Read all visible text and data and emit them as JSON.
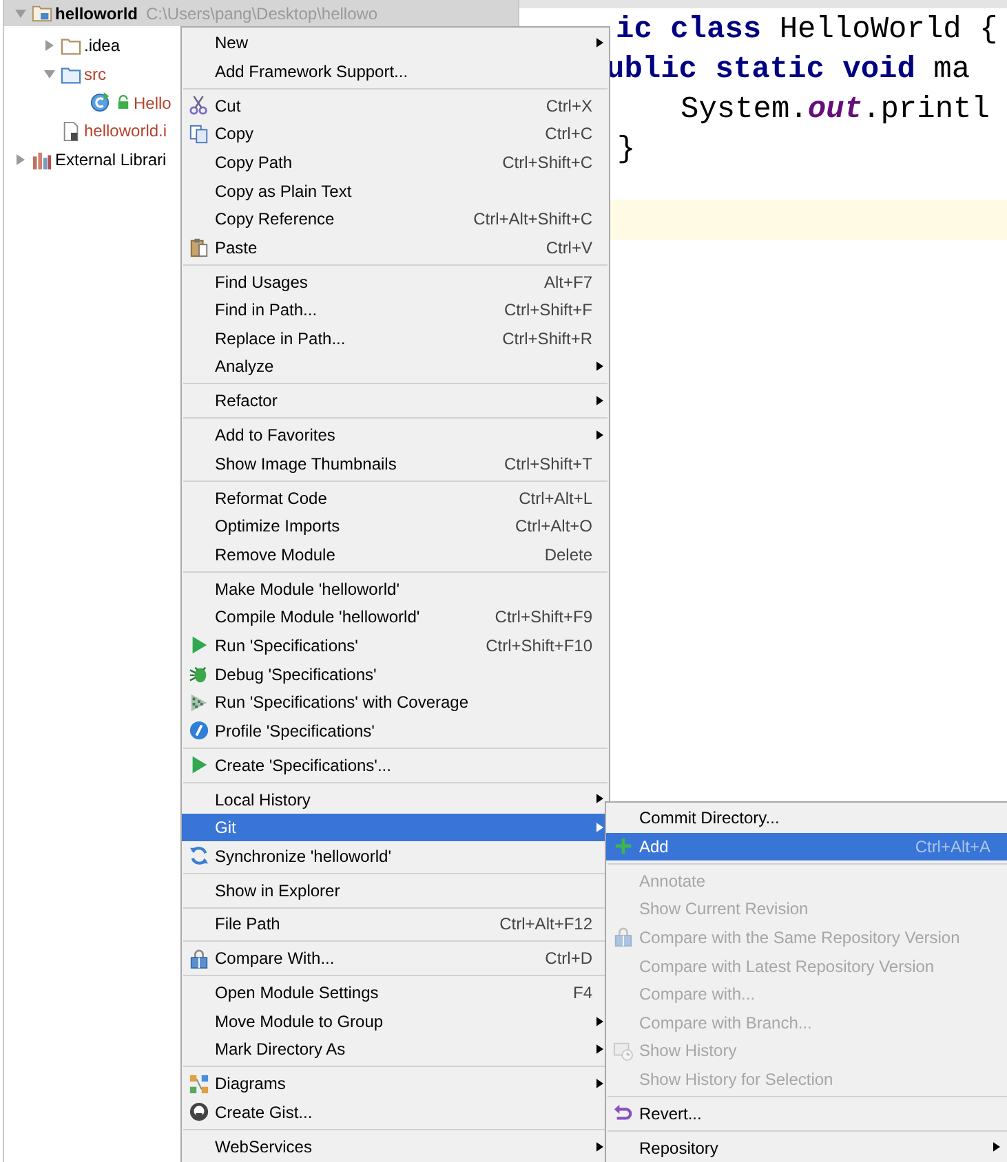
{
  "project_tree": {
    "items": [
      {
        "label": "helloworld",
        "path": "C:\\Users\\pang\\Desktop\\hellowo",
        "kind": "module",
        "expanded": true,
        "unversioned": false,
        "selected": true,
        "children": [
          {
            "label": ".idea",
            "kind": "folder",
            "expanded": false,
            "unversioned": false,
            "selected": false
          },
          {
            "label": "src",
            "kind": "source_folder",
            "expanded": true,
            "unversioned": true,
            "selected": false,
            "children": [
              {
                "label": "Hello",
                "kind": "class",
                "unversioned": true,
                "selected": false
              }
            ]
          },
          {
            "label": "helloworld.i",
            "kind": "module_file",
            "unversioned": true,
            "selected": false
          }
        ]
      },
      {
        "label": "External Librari",
        "kind": "libraries",
        "expanded": false,
        "unversioned": false,
        "selected": false
      }
    ]
  },
  "editor": {
    "lines": [
      {
        "current": false,
        "tokens": [
          {
            "text": "ic ",
            "kind": "keyword"
          },
          {
            "text": "class ",
            "kind": "keyword"
          },
          {
            "text": "HelloWorld {",
            "kind": "plain"
          }
        ]
      },
      {
        "current": false,
        "tokens": [
          {
            "text": "ublic static void ",
            "kind": "keyword"
          },
          {
            "text": "ma",
            "kind": "plain"
          }
        ]
      },
      {
        "current": false,
        "tokens": [
          {
            "text": "System.",
            "kind": "plain"
          },
          {
            "text": "out",
            "kind": "field"
          },
          {
            "text": ".printl",
            "kind": "plain"
          }
        ]
      },
      {
        "current": false,
        "tokens": [
          {
            "text": "}",
            "kind": "plain"
          }
        ]
      },
      {
        "current": true
      }
    ]
  },
  "context_menu": {
    "groups": [
      {
        "items": [
          {
            "label": "New",
            "kind": "plain",
            "submenu": true,
            "selected": false
          },
          {
            "label": "Add Framework Support...",
            "kind": "plain",
            "submenu": false,
            "selected": false
          }
        ]
      },
      {
        "items": [
          {
            "label": "Cut",
            "shortcut": "Ctrl+X",
            "kind": "cut",
            "submenu": false,
            "selected": false
          },
          {
            "label": "Copy",
            "shortcut": "Ctrl+C",
            "kind": "copy",
            "submenu": false,
            "selected": false
          },
          {
            "label": "Copy Path",
            "shortcut": "Ctrl+Shift+C",
            "kind": "plain",
            "submenu": false,
            "selected": false
          },
          {
            "label": "Copy as Plain Text",
            "kind": "plain",
            "submenu": false,
            "selected": false
          },
          {
            "label": "Copy Reference",
            "shortcut": "Ctrl+Alt+Shift+C",
            "kind": "plain",
            "submenu": false,
            "selected": false
          },
          {
            "label": "Paste",
            "shortcut": "Ctrl+V",
            "kind": "paste",
            "submenu": false,
            "selected": false
          }
        ]
      },
      {
        "items": [
          {
            "label": "Find Usages",
            "shortcut": "Alt+F7",
            "kind": "plain",
            "submenu": false,
            "selected": false
          },
          {
            "label": "Find in Path...",
            "shortcut": "Ctrl+Shift+F",
            "kind": "plain",
            "submenu": false,
            "selected": false
          },
          {
            "label": "Replace in Path...",
            "shortcut": "Ctrl+Shift+R",
            "kind": "plain",
            "submenu": false,
            "selected": false
          },
          {
            "label": "Analyze",
            "kind": "plain",
            "submenu": true,
            "selected": false
          }
        ]
      },
      {
        "items": [
          {
            "label": "Refactor",
            "kind": "plain",
            "submenu": true,
            "selected": false
          }
        ]
      },
      {
        "items": [
          {
            "label": "Add to Favorites",
            "kind": "plain",
            "submenu": true,
            "selected": false
          },
          {
            "label": "Show Image Thumbnails",
            "shortcut": "Ctrl+Shift+T",
            "kind": "plain",
            "submenu": false,
            "selected": false
          }
        ]
      },
      {
        "items": [
          {
            "label": "Reformat Code",
            "shortcut": "Ctrl+Alt+L",
            "kind": "plain",
            "submenu": false,
            "selected": false
          },
          {
            "label": "Optimize Imports",
            "shortcut": "Ctrl+Alt+O",
            "kind": "plain",
            "submenu": false,
            "selected": false
          },
          {
            "label": "Remove Module",
            "shortcut": "Delete",
            "kind": "plain",
            "submenu": false,
            "selected": false
          }
        ]
      },
      {
        "items": [
          {
            "label": "Make Module 'helloworld'",
            "kind": "plain",
            "submenu": false,
            "selected": false
          },
          {
            "label": "Compile Module 'helloworld'",
            "shortcut": "Ctrl+Shift+F9",
            "kind": "plain",
            "submenu": false,
            "selected": false
          },
          {
            "label": "Run 'Specifications'",
            "shortcut": "Ctrl+Shift+F10",
            "kind": "run",
            "submenu": false,
            "selected": false
          },
          {
            "label": "Debug 'Specifications'",
            "kind": "debug",
            "submenu": false,
            "selected": false
          },
          {
            "label": "Run 'Specifications' with Coverage",
            "kind": "coverage",
            "submenu": false,
            "selected": false
          },
          {
            "label": "Profile 'Specifications'",
            "kind": "profile",
            "submenu": false,
            "selected": false
          }
        ]
      },
      {
        "items": [
          {
            "label": "Create 'Specifications'...",
            "kind": "run",
            "submenu": false,
            "selected": false
          }
        ]
      },
      {
        "items": [
          {
            "label": "Local History",
            "kind": "plain",
            "submenu": true,
            "selected": false
          },
          {
            "label": "Git",
            "kind": "plain",
            "submenu": true,
            "selected": true
          },
          {
            "label": "Synchronize 'helloworld'",
            "kind": "sync",
            "submenu": false,
            "selected": false
          }
        ]
      },
      {
        "items": [
          {
            "label": "Show in Explorer",
            "kind": "plain",
            "submenu": false,
            "selected": false
          }
        ]
      },
      {
        "items": [
          {
            "label": "File Path",
            "shortcut": "Ctrl+Alt+F12",
            "kind": "plain",
            "submenu": false,
            "selected": false
          }
        ]
      },
      {
        "items": [
          {
            "label": "Compare With...",
            "shortcut": "Ctrl+D",
            "kind": "compare",
            "submenu": false,
            "selected": false
          }
        ]
      },
      {
        "items": [
          {
            "label": "Open Module Settings",
            "shortcut": "F4",
            "kind": "plain",
            "submenu": false,
            "selected": false
          },
          {
            "label": "Move Module to Group",
            "kind": "plain",
            "submenu": true,
            "selected": false
          },
          {
            "label": "Mark Directory As",
            "kind": "plain",
            "submenu": true,
            "selected": false
          }
        ]
      },
      {
        "items": [
          {
            "label": "Diagrams",
            "kind": "diagrams",
            "submenu": true,
            "selected": false
          },
          {
            "label": "Create Gist...",
            "kind": "gist",
            "submenu": false,
            "selected": false
          }
        ]
      },
      {
        "items": [
          {
            "label": "WebServices",
            "kind": "plain",
            "submenu": true,
            "selected": false
          }
        ]
      }
    ]
  },
  "git_submenu": {
    "groups": [
      {
        "items": [
          {
            "label": "Commit Directory...",
            "kind": "plain",
            "submenu": false,
            "selected": false,
            "disabled": false
          },
          {
            "label": "Add",
            "shortcut": "Ctrl+Alt+A",
            "kind": "add",
            "submenu": false,
            "selected": true,
            "disabled": false
          }
        ]
      },
      {
        "items": [
          {
            "label": "Annotate",
            "kind": "plain",
            "submenu": false,
            "selected": false,
            "disabled": true
          },
          {
            "label": "Show Current Revision",
            "kind": "plain",
            "submenu": false,
            "selected": false,
            "disabled": true
          },
          {
            "label": "Compare with the Same Repository Version",
            "kind": "compare",
            "submenu": false,
            "selected": false,
            "disabled": true
          },
          {
            "label": "Compare with Latest Repository Version",
            "kind": "plain",
            "submenu": false,
            "selected": false,
            "disabled": true
          },
          {
            "label": "Compare with...",
            "kind": "plain",
            "submenu": false,
            "selected": false,
            "disabled": true
          },
          {
            "label": "Compare with Branch...",
            "kind": "plain",
            "submenu": false,
            "selected": false,
            "disabled": true
          },
          {
            "label": "Show History",
            "kind": "history",
            "submenu": false,
            "selected": false,
            "disabled": true
          },
          {
            "label": "Show History for Selection",
            "kind": "plain",
            "submenu": false,
            "selected": false,
            "disabled": true
          }
        ]
      },
      {
        "items": [
          {
            "label": "Revert...",
            "kind": "revert",
            "submenu": false,
            "selected": false,
            "disabled": false
          }
        ]
      },
      {
        "items": [
          {
            "label": "Repository",
            "kind": "plain",
            "submenu": true,
            "selected": false,
            "disabled": false
          }
        ]
      }
    ]
  }
}
